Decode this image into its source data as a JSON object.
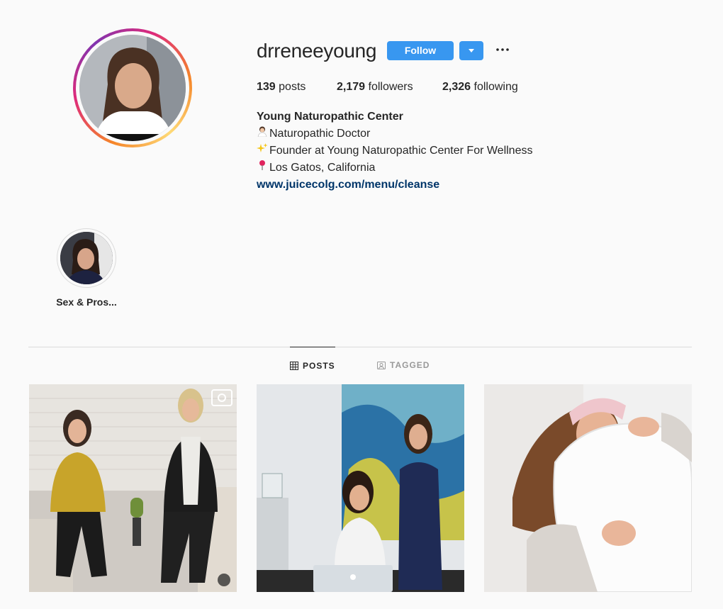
{
  "profile": {
    "username": "drreneeyoung",
    "follow_label": "Follow",
    "stats": {
      "posts_count": "139",
      "posts_label": "posts",
      "followers_count": "2,179",
      "followers_label": "followers",
      "following_count": "2,326",
      "following_label": "following"
    },
    "bio": {
      "full_name": "Young Naturopathic Center",
      "line1": "Naturopathic Doctor",
      "line2": "Founder at Young Naturopathic Center For Wellness",
      "line3": "Los Gatos, California",
      "link": "www.juicecolg.com/menu/cleanse"
    }
  },
  "highlights": [
    {
      "label": "Sex & Pros..."
    }
  ],
  "tabs": [
    {
      "label": "POSTS",
      "icon": "grid-icon",
      "active": true
    },
    {
      "label": "TAGGED",
      "icon": "tagged-icon",
      "active": false
    }
  ],
  "colors": {
    "accent": "#3897f0",
    "link": "#003569",
    "background": "#fafafa"
  }
}
